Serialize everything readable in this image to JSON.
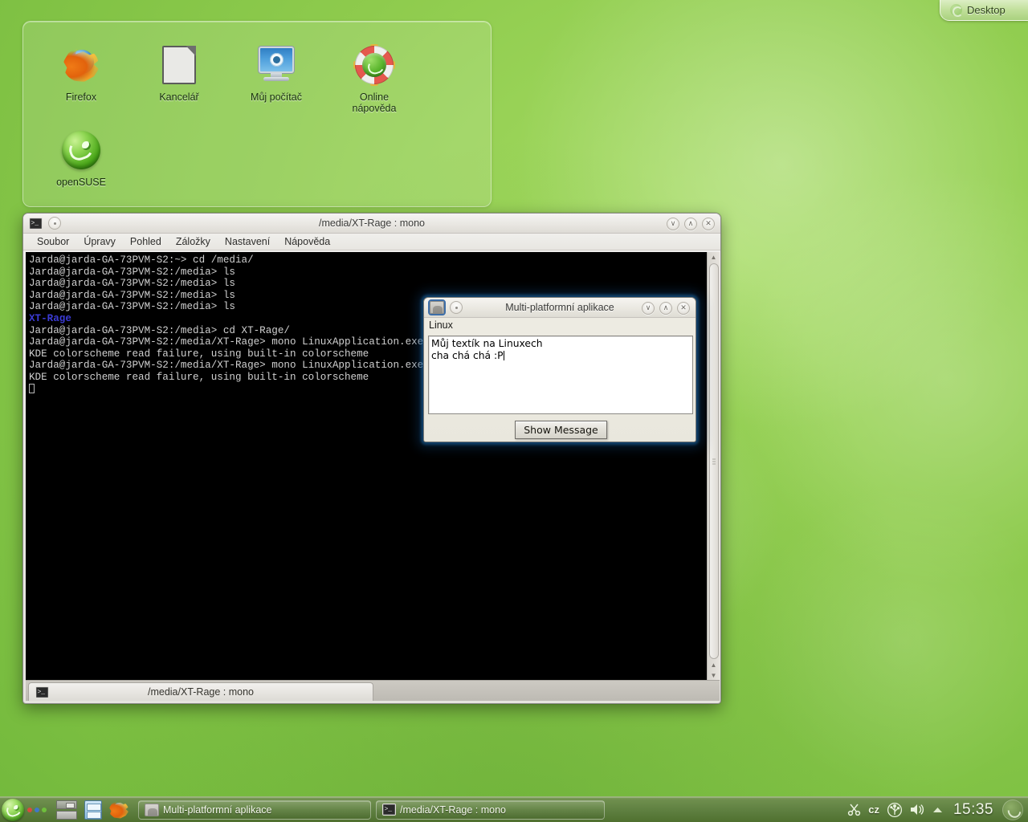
{
  "desktop": {
    "toolbox_label": "Desktop",
    "toolbox_icon": "cashew-icon",
    "wallpaper_color": "#8ecb4d",
    "icons": [
      {
        "label": "Firefox",
        "icon": "firefox-icon"
      },
      {
        "label": "Kancelář",
        "icon": "office-document-icon"
      },
      {
        "label": "Můj počítač",
        "icon": "my-computer-icon"
      },
      {
        "label": "Online\nnápověda",
        "label_line1": "Online",
        "label_line2": "nápověda",
        "icon": "online-help-icon"
      },
      {
        "label": "openSUSE",
        "icon": "opensuse-gecko-icon"
      }
    ]
  },
  "konsole": {
    "title": "/media/XT-Rage : mono",
    "app_icon": "konsole-icon",
    "pin_icon": "sticky-dot-icon",
    "window_buttons": [
      {
        "name": "minimize",
        "glyph": "∨"
      },
      {
        "name": "maximize",
        "glyph": "∧"
      },
      {
        "name": "close",
        "glyph": "✕"
      }
    ],
    "menu": [
      "Soubor",
      "Úpravy",
      "Pohled",
      "Záložky",
      "Nastavení",
      "Nápověda"
    ],
    "lines": [
      {
        "text": "Jarda@jarda-GA-73PVM-S2:~> cd /media/",
        "style": "normal"
      },
      {
        "text": "Jarda@jarda-GA-73PVM-S2:/media> ls",
        "style": "normal"
      },
      {
        "text": "Jarda@jarda-GA-73PVM-S2:/media> ls",
        "style": "normal"
      },
      {
        "text": "Jarda@jarda-GA-73PVM-S2:/media> ls",
        "style": "normal"
      },
      {
        "text": "Jarda@jarda-GA-73PVM-S2:/media> ls",
        "style": "normal"
      },
      {
        "text": "XT-Rage",
        "style": "dir"
      },
      {
        "text": "Jarda@jarda-GA-73PVM-S2:/media> cd XT-Rage/",
        "style": "normal"
      },
      {
        "text": "Jarda@jarda-GA-73PVM-S2:/media/XT-Rage> mono LinuxApplication.exe",
        "style": "normal"
      },
      {
        "text": "KDE colorscheme read failure, using built-in colorscheme",
        "style": "normal"
      },
      {
        "text": "Jarda@jarda-GA-73PVM-S2:/media/XT-Rage> mono LinuxApplication.exe",
        "style": "normal"
      },
      {
        "text": "KDE colorscheme read failure, using built-in colorscheme",
        "style": "normal"
      }
    ],
    "dir_color": "#3b3bd6",
    "foreground": "#d0d0d0",
    "background": "#000000",
    "tab_label": "/media/XT-Rage : mono",
    "tab_icon": "konsole-icon"
  },
  "dialog": {
    "title": "Multi-platformní aplikace",
    "app_icon": "mono-app-icon",
    "pin_icon": "sticky-dot-icon",
    "window_buttons": [
      {
        "name": "minimize",
        "glyph": "∨"
      },
      {
        "name": "maximize",
        "glyph": "∧"
      },
      {
        "name": "close",
        "glyph": "✕"
      }
    ],
    "platform_label": "Linux",
    "textarea_line1": "Můj textík na Linuxech",
    "textarea_line2": "cha chá chá :P",
    "button_label": "Show Message"
  },
  "taskbar": {
    "kickoff_icon": "opensuse-kickoff-icon",
    "activity_dots": [
      "#d94b3d",
      "#3f78c8",
      "#6fbf3c"
    ],
    "pager": [
      {
        "name": "desktop-1",
        "active": true
      },
      {
        "name": "desktop-2",
        "active": false
      }
    ],
    "launchers": [
      {
        "name": "file-manager-icon",
        "icon": "dolphin-icon"
      },
      {
        "name": "firefox-launcher-icon",
        "icon": "firefox-icon"
      }
    ],
    "tasks": [
      {
        "label": "Multi-platformní aplikace",
        "icon": "mono-app-icon"
      },
      {
        "label": "/media/XT-Rage : mono",
        "icon": "konsole-icon"
      }
    ],
    "tray": [
      {
        "name": "klipper-scissors-icon"
      },
      {
        "name": "keyboard-layout-indicator",
        "label": "cz"
      },
      {
        "name": "usb-device-icon"
      },
      {
        "name": "volume-icon"
      },
      {
        "name": "tray-expand-arrow-icon"
      }
    ],
    "clock": "15:35",
    "lock_icon": "lock-session-icon"
  }
}
